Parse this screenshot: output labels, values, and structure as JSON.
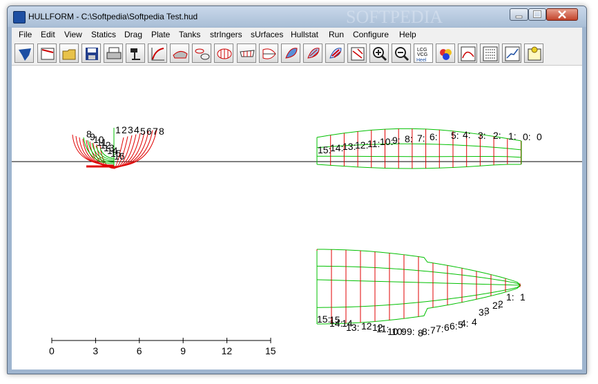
{
  "window": {
    "title": "HULLFORM - C:\\Softpedia\\Softpedia Test.hud",
    "watermark": "SOFTPEDIA"
  },
  "menu": [
    "File",
    "Edit",
    "View",
    "Statics",
    "Drag",
    "Plate",
    "Tanks",
    "strIngers",
    "sUrfaces",
    "Hullstat",
    "Run",
    "Configure",
    "Help"
  ],
  "toolbar": {
    "icons": [
      "hullform-logo-icon",
      "new-design-icon",
      "open-folder-icon",
      "save-disk-icon",
      "print-icon",
      "plotter-icon",
      "curve-edit-icon",
      "hull-3d-icon",
      "sections-icon",
      "body-plan-icon",
      "profile-icon",
      "plan-view-icon",
      "render-shaded-icon",
      "render-lines-icon",
      "render-stripes-icon",
      "transom-icon",
      "zoom-in-icon",
      "zoom-out-icon",
      "lcg-vcg-heel-icon",
      "color-palette-icon",
      "curve-plot-icon",
      "hydrostatics-table-icon",
      "speed-graph-icon",
      "notes-icon"
    ],
    "lcg_text": "LCG",
    "vcg_text": "VCG",
    "heel_text": "Heel"
  },
  "drawing": {
    "scale_ticks": [
      "0",
      "3",
      "6",
      "9",
      "12",
      "15"
    ],
    "profile_labels": [
      "15:",
      "14:",
      "13:",
      "12:",
      "11:",
      "10:",
      "9:",
      "8:",
      "7:",
      "6:",
      "5:",
      "4:",
      "3:",
      "2:",
      "1:",
      "0:",
      "0"
    ],
    "plan_labels": [
      "15:",
      "15",
      "14:",
      "14",
      "13:",
      "12",
      "12:",
      "11:",
      "10",
      "10:",
      "9",
      "9:",
      "8",
      "8:",
      "7",
      "7:",
      "6",
      "6:",
      "5",
      "4:",
      "4",
      "3:",
      "3",
      "2:",
      "2",
      "1:",
      "1"
    ],
    "body_labels_left": [
      "8",
      "9",
      "10",
      "11",
      "12",
      "13",
      "14",
      "15",
      "16"
    ],
    "body_labels_right": [
      "1",
      "2",
      "3",
      "4",
      "5",
      "6",
      "7",
      "8"
    ],
    "colors": {
      "stations": "#e00000",
      "waterlines": "#00c000",
      "baseline": "#000000"
    }
  }
}
